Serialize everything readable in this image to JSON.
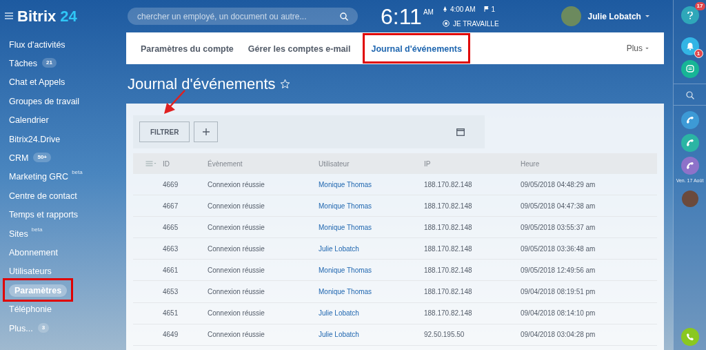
{
  "logo": {
    "text": "Bitrix",
    "accent": "24"
  },
  "search": {
    "placeholder": "chercher un employé, un document ou autre..."
  },
  "clock": {
    "time": "6:11",
    "ampm": "AM",
    "alarm": "4:00 AM",
    "flags": "1",
    "status": "JE TRAVAILLE"
  },
  "user": {
    "name": "Julie Lobatch"
  },
  "sidebar": {
    "items": [
      {
        "label": "Flux d'activités",
        "selected": false,
        "highlighted": false
      },
      {
        "label": "Tâches",
        "badge": "21",
        "selected": false,
        "highlighted": false
      },
      {
        "label": "Chat et Appels",
        "selected": false,
        "highlighted": false
      },
      {
        "label": "Groupes de travail",
        "selected": false,
        "highlighted": false
      },
      {
        "label": "Calendrier",
        "selected": false,
        "highlighted": false
      },
      {
        "label": "Bitrix24.Drive",
        "selected": false,
        "highlighted": false
      },
      {
        "label": "CRM",
        "badge": "50+",
        "selected": false,
        "highlighted": false
      },
      {
        "label": "Marketing GRC",
        "tag": "beta",
        "selected": false,
        "highlighted": false
      },
      {
        "label": "Centre de contact",
        "selected": false,
        "highlighted": false
      },
      {
        "label": "Temps et rapports",
        "selected": false,
        "highlighted": false
      },
      {
        "label": "Sites",
        "tag": "beta",
        "selected": false,
        "highlighted": false
      },
      {
        "label": "Abonnement",
        "selected": false,
        "highlighted": false
      },
      {
        "label": "Utilisateurs",
        "selected": false,
        "highlighted": false
      },
      {
        "label": "Paramètres",
        "selected": true,
        "highlighted": true
      },
      {
        "label": "Téléphonie",
        "selected": false,
        "highlighted": false
      },
      {
        "label": "Plus...",
        "badge": "3",
        "selected": false,
        "highlighted": false
      }
    ]
  },
  "tabs": [
    {
      "label": "Paramètres du compte",
      "selected": false,
      "highlighted": false
    },
    {
      "label": "Gérer les comptes e-mail",
      "selected": false,
      "highlighted": false
    },
    {
      "label": "Journal d'événements",
      "selected": true,
      "highlighted": true
    }
  ],
  "more_menu": "Plus",
  "page_title": "Journal d'événements",
  "filter": {
    "button": "FILTRER"
  },
  "table": {
    "columns": [
      "ID",
      "Évènement",
      "Utilisateur",
      "IP",
      "Heure"
    ],
    "rows": [
      [
        "4669",
        "Connexion réussie",
        "Monique Thomas",
        "188.170.82.148",
        "09/05/2018 04:48:29 am"
      ],
      [
        "4667",
        "Connexion réussie",
        "Monique Thomas",
        "188.170.82.148",
        "09/05/2018 04:47:38 am"
      ],
      [
        "4665",
        "Connexion réussie",
        "Monique Thomas",
        "188.170.82.148",
        "09/05/2018 03:55:37 am"
      ],
      [
        "4663",
        "Connexion réussie",
        "Julie Lobatch",
        "188.170.82.148",
        "09/05/2018 03:36:48 am"
      ],
      [
        "4661",
        "Connexion réussie",
        "Monique Thomas",
        "188.170.82.148",
        "09/05/2018 12:49:56 am"
      ],
      [
        "4653",
        "Connexion réussie",
        "Monique Thomas",
        "188.170.82.148",
        "09/04/2018 08:19:51 pm"
      ],
      [
        "4651",
        "Connexion réussie",
        "Julie Lobatch",
        "188.170.82.148",
        "09/04/2018 08:14:10 pm"
      ],
      [
        "4649",
        "Connexion réussie",
        "Julie Lobatch",
        "92.50.195.50",
        "09/04/2018 03:04:28 pm"
      ]
    ]
  },
  "right_bar": {
    "help_badge": "17",
    "notify_badge": "1",
    "date": "Ven. 17 Août",
    "calls": [
      {
        "color": "#3d9ad6"
      },
      {
        "color": "#2bb5a4"
      },
      {
        "color": "#8e72c9"
      }
    ]
  }
}
